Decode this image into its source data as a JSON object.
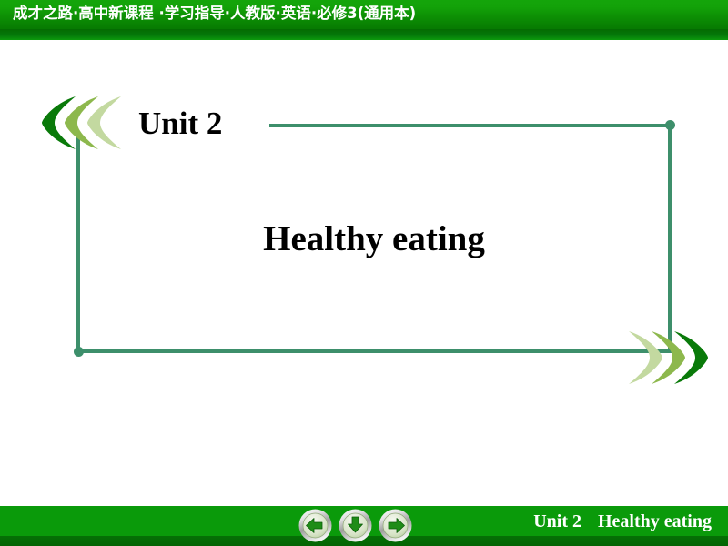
{
  "header": {
    "title": "成才之路·高中新课程 ·学习指导·人教版·英语·必修3(通用本)",
    "bar_color": "#0e9a07"
  },
  "body": {
    "unit_label": "Unit 2",
    "title": "Healthy eating",
    "frame_color": "#3d8f6b",
    "chevron_colors": {
      "dark": "#0a7a0a",
      "medium": "#8db84d",
      "light": "#c3d9a0"
    }
  },
  "footer": {
    "unit_label": "Unit 2",
    "title": "Healthy eating",
    "bar_color": "#0a9a0a",
    "nav": {
      "prev_label": "Previous slide",
      "down_label": "Next step",
      "next_label": "Next slide"
    }
  }
}
